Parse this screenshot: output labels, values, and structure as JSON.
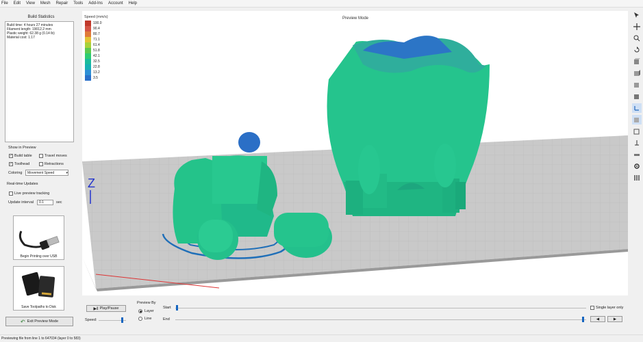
{
  "menu": [
    "File",
    "Edit",
    "View",
    "Mesh",
    "Repair",
    "Tools",
    "Add-Ins",
    "Account",
    "Help"
  ],
  "left": {
    "title": "Build Statistics",
    "stats": [
      "Build time: 4 hours 27 minutes",
      "Filament length: 19012.2 mm",
      "Plastic weight: 62.38 g (0.14 lb)",
      "Material cost: 1.17"
    ],
    "show_label": "Show in Preview",
    "checks": [
      {
        "label": "Build table",
        "checked": "✓"
      },
      {
        "label": "Travel moves",
        "checked": ""
      },
      {
        "label": "Toolhead",
        "checked": "✓"
      },
      {
        "label": "Retractions",
        "checked": ""
      }
    ],
    "coloring_label": "Coloring",
    "coloring_value": "Movement Speed",
    "realtime_label": "Real-time Updates",
    "live_label": "Live preview tracking",
    "interval_label": "Update interval",
    "interval_value": "0.1",
    "interval_unit": "sec",
    "usb_label": "Begin Printing over USB",
    "sd_label": "Save Toolpaths to Disk",
    "exit_label": "Exit Preview Mode"
  },
  "viewport": {
    "mode": "Preview Mode",
    "legend_title": "Speed (mm/s)",
    "legend": [
      {
        "value": "100.0",
        "color": "#c0392b"
      },
      {
        "value": "90.4",
        "color": "#d35445"
      },
      {
        "value": "80.7",
        "color": "#e07b39"
      },
      {
        "value": "71.1",
        "color": "#e3c234"
      },
      {
        "value": "61.4",
        "color": "#a8d13a"
      },
      {
        "value": "51.8",
        "color": "#5cc94f"
      },
      {
        "value": "42.1",
        "color": "#2ecc71"
      },
      {
        "value": "32.5",
        "color": "#1abc9c"
      },
      {
        "value": "22.8",
        "color": "#16b1b3"
      },
      {
        "value": "13.2",
        "color": "#2d8fd5"
      },
      {
        "value": "3.5",
        "color": "#2a6fc9"
      }
    ],
    "axis_z": "Z"
  },
  "bottom": {
    "play_label": "Play/Pause",
    "speed_label": "Speed:",
    "preview_by": "Preview By",
    "layer_label": "Layer",
    "line_label": "Line",
    "start_label": "Start",
    "end_label": "End",
    "single_layer": "Single layer only",
    "prev": "◀",
    "next": "▶"
  },
  "status": "Previewing file from line 1 to 647034 (layer 0 to 583)"
}
